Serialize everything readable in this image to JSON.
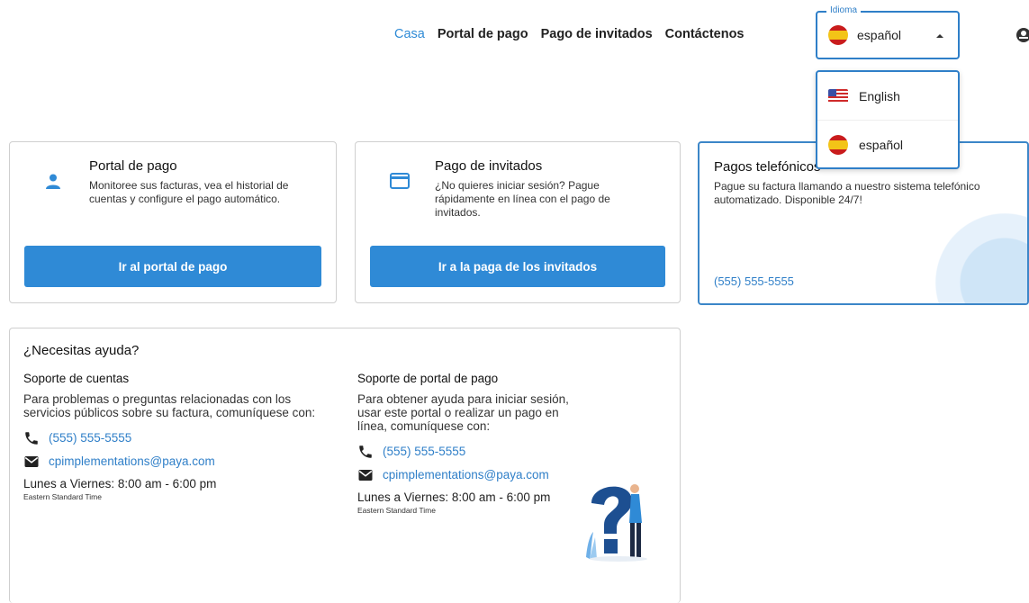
{
  "nav": {
    "items": [
      {
        "label": "Casa",
        "active": true
      },
      {
        "label": "Portal de pago"
      },
      {
        "label": "Pago de invitados"
      },
      {
        "label": "Contáctenos"
      }
    ]
  },
  "language": {
    "legend": "Idioma",
    "selected": "español",
    "options": [
      "English",
      "español"
    ]
  },
  "cards": {
    "portal": {
      "title": "Portal de pago",
      "description": "Monitoree sus facturas, vea el historial de cuentas y configure el pago automático.",
      "button": "Ir al portal de pago"
    },
    "guest": {
      "title": "Pago de invitados",
      "description": "¿No quieres iniciar sesión? Pague rápidamente en línea con el pago de invitados.",
      "button": "Ir a la paga de los invitados"
    },
    "phone": {
      "title": "Pagos telefónicos",
      "description": "Pague su factura llamando a nuestro sistema telefónico automatizado. Disponible 24/7!",
      "phone": "(555) 555-5555"
    }
  },
  "help": {
    "title": "¿Necesitas ayuda?",
    "accounts": {
      "heading": "Soporte de cuentas",
      "text": "Para problemas o preguntas relacionadas con los servicios públicos sobre su factura, comuníquese con:",
      "phone": "(555) 555-5555",
      "email": "cpimplementations@paya.com",
      "hours": "Lunes a Viernes: 8:00 am - 6:00 pm",
      "timezone": "Eastern Standard Time"
    },
    "portal": {
      "heading": "Soporte de portal de pago",
      "text": "Para obtener ayuda para iniciar sesión, usar este portal o realizar un pago en línea, comuníquese con:",
      "phone": "(555) 555-5555",
      "email": "cpimplementations@paya.com",
      "hours": "Lunes a Viernes: 8:00 am - 6:00 pm",
      "timezone": "Eastern Standard Time"
    }
  },
  "colors": {
    "primary": "#2f8ad6",
    "link": "#2f7fc8",
    "border": "#cfcfcf"
  }
}
